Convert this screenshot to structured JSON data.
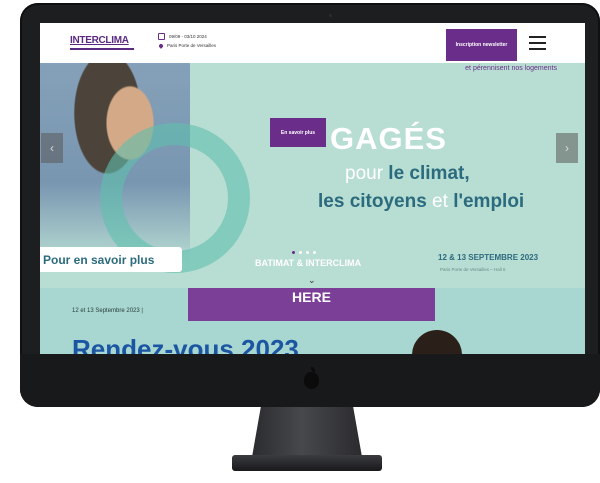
{
  "header": {
    "logo": "INTERCLIMA",
    "dates": "09/09 - 03/10 2024",
    "location": "Paris Porte de Versailles",
    "newsletter_label": "Inscription newsletter"
  },
  "hero": {
    "top_text": "et pérennisent nos logements",
    "button_label": "En savoir plus",
    "headline": "GAGÉS",
    "line2_light": "pour",
    "line2_accent": " le climat,",
    "line3_accent": "les citoyens",
    "line3_light": " et ",
    "line3_end": "l'emploi",
    "learn_more_label": "Pour en savoir plus",
    "brands": "BATIMAT & INTERCLIMA",
    "dates": "12 & 13 SEPTEMBRE 2023",
    "venue": "Paris Porte de Versailles – Hall 6",
    "arrow_left": "‹",
    "arrow_right": "›",
    "chevron": "⌄"
  },
  "content": {
    "highlight_label": "HERE",
    "subtitle": "12 et 13 Septembre 2023 |",
    "title": "Rendez-vous 2023"
  },
  "colors": {
    "brand_purple": "#6a2d89",
    "hero_mint": "#b8ddd3",
    "title_blue": "#1c56a3"
  }
}
